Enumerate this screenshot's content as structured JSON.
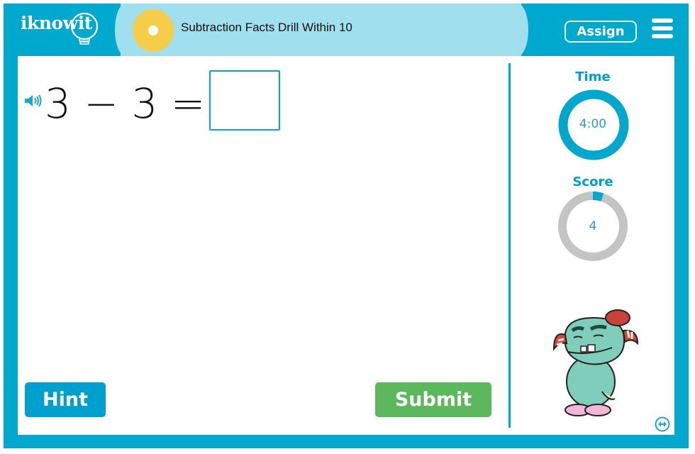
{
  "header": {
    "logo_text": "iknowit",
    "title": "Subtraction Facts Drill Within 10",
    "assign_label": "Assign",
    "menu_icon": "hamburger-menu-icon"
  },
  "question": {
    "speaker_icon": "speaker-icon",
    "equation": "3 − 3 =",
    "answer_value": "",
    "answer_placeholder": ""
  },
  "buttons": {
    "hint_label": "Hint",
    "submit_label": "Submit"
  },
  "sidebar": {
    "time_label": "Time",
    "time_value": "4:00",
    "time_progress": 1.0,
    "score_label": "Score",
    "score_value": "4",
    "score_progress": 0.05,
    "mascot": "monster-mascot",
    "expand_icon": "expand-arrows-icon"
  },
  "colors": {
    "brand_blue": "#00a8cd",
    "header_light": "#9fdfee",
    "disc_yellow": "#f5cd48",
    "submit_green": "#5cb85c",
    "ring_gray": "#c4c4c4"
  }
}
